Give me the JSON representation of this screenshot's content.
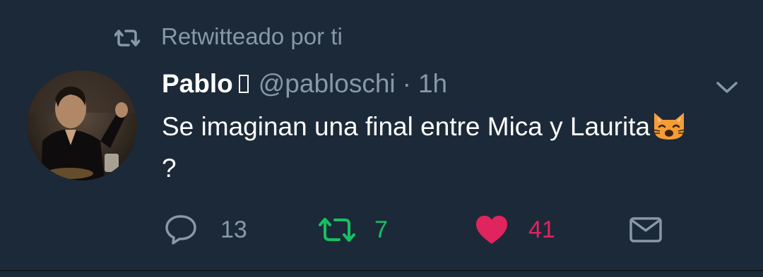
{
  "context": {
    "retweet_label": "Retwitteado por ti"
  },
  "author": {
    "name": "Pablo",
    "name_glyph": "",
    "handle": "@pabloschi",
    "separator": "·",
    "time": "1h"
  },
  "tweet": {
    "text_part1": "Se imaginan una final entre Mica y Laurita",
    "emoji": "weary-cat-emoji",
    "text_part2": "?"
  },
  "actions": {
    "replies": "13",
    "retweets": "7",
    "likes": "41"
  },
  "colors": {
    "background": "#1c2938",
    "secondary_text": "#8899a6",
    "retweet_green": "#17bf63",
    "like_pink": "#e0245e",
    "primary_text": "#ffffff"
  },
  "icons": {
    "retweet_context": "retweet-icon",
    "caret": "chevron-down-icon",
    "reply": "reply-icon",
    "retweet": "retweet-icon",
    "like": "heart-icon",
    "dm": "envelope-icon"
  }
}
